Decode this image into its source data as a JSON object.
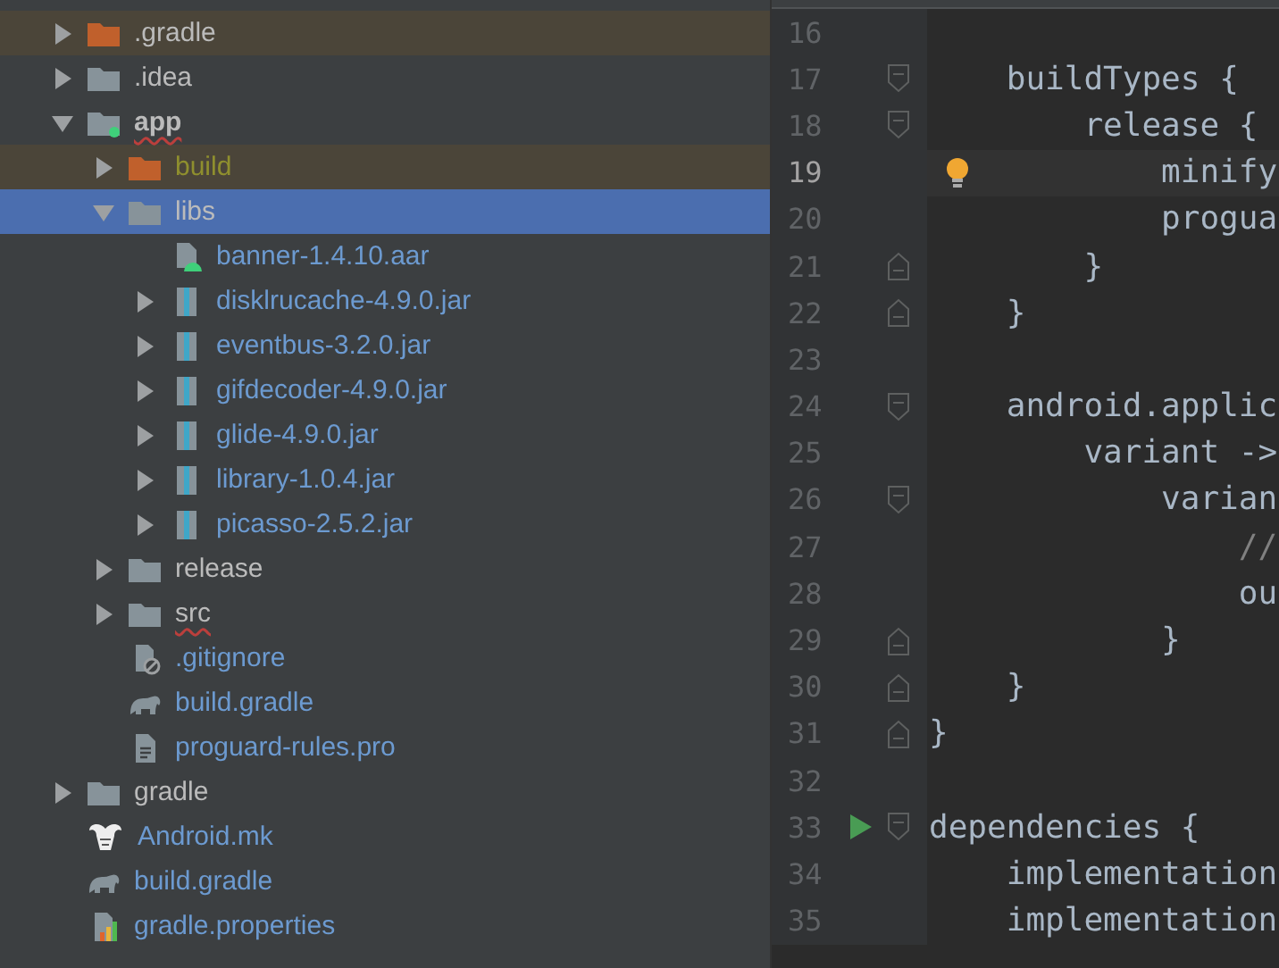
{
  "project_tree": {
    "items": [
      {
        "name": ".gradle",
        "kind": "folder-excluded",
        "expanded": false,
        "selected": false,
        "highlighted": true,
        "unversioned": false,
        "ignored": false,
        "bold": false,
        "error": false
      },
      {
        "name": ".idea",
        "kind": "folder",
        "expanded": false,
        "selected": false,
        "highlighted": false,
        "unversioned": false,
        "ignored": false,
        "bold": false,
        "error": false
      },
      {
        "name": "app",
        "kind": "module",
        "expanded": true,
        "selected": false,
        "highlighted": false,
        "unversioned": false,
        "ignored": false,
        "bold": true,
        "error": true,
        "children": [
          {
            "name": "build",
            "kind": "folder-excluded",
            "expanded": false,
            "selected": false,
            "highlighted": true,
            "ignored": true,
            "bold": false,
            "error": false
          },
          {
            "name": "libs",
            "kind": "folder",
            "expanded": true,
            "selected": true,
            "highlighted": false,
            "unversioned": false,
            "ignored": false,
            "bold": false,
            "error": false,
            "children": [
              {
                "name": "banner-1.4.10.aar",
                "kind": "aar",
                "selected": false,
                "highlighted": false,
                "unversioned": true,
                "ignored": false,
                "bold": false,
                "error": false
              },
              {
                "name": "disklrucache-4.9.0.jar",
                "kind": "jar",
                "expanded": false,
                "selected": false,
                "highlighted": false,
                "unversioned": true,
                "ignored": false,
                "bold": false,
                "error": false
              },
              {
                "name": "eventbus-3.2.0.jar",
                "kind": "jar",
                "expanded": false,
                "selected": false,
                "highlighted": false,
                "unversioned": true,
                "ignored": false,
                "bold": false,
                "error": false
              },
              {
                "name": "gifdecoder-4.9.0.jar",
                "kind": "jar",
                "expanded": false,
                "selected": false,
                "highlighted": false,
                "unversioned": true,
                "ignored": false,
                "bold": false,
                "error": false
              },
              {
                "name": "glide-4.9.0.jar",
                "kind": "jar",
                "expanded": false,
                "selected": false,
                "highlighted": false,
                "unversioned": true,
                "ignored": false,
                "bold": false,
                "error": false
              },
              {
                "name": "library-1.0.4.jar",
                "kind": "jar",
                "expanded": false,
                "selected": false,
                "highlighted": false,
                "unversioned": true,
                "ignored": false,
                "bold": false,
                "error": false
              },
              {
                "name": "picasso-2.5.2.jar",
                "kind": "jar",
                "expanded": false,
                "selected": false,
                "highlighted": false,
                "unversioned": true,
                "ignored": false,
                "bold": false,
                "error": false
              }
            ]
          },
          {
            "name": "release",
            "kind": "folder",
            "expanded": false,
            "selected": false,
            "highlighted": false,
            "unversioned": false,
            "ignored": false,
            "bold": false,
            "error": false
          },
          {
            "name": "src",
            "kind": "folder",
            "expanded": false,
            "selected": false,
            "highlighted": false,
            "unversioned": false,
            "ignored": false,
            "bold": false,
            "error": true
          },
          {
            "name": ".gitignore",
            "kind": "gitignore",
            "selected": false,
            "highlighted": false,
            "unversioned": true,
            "ignored": false,
            "bold": false,
            "error": false
          },
          {
            "name": "build.gradle",
            "kind": "gradle",
            "selected": false,
            "highlighted": false,
            "unversioned": true,
            "ignored": false,
            "bold": false,
            "error": false
          },
          {
            "name": "proguard-rules.pro",
            "kind": "text",
            "selected": false,
            "highlighted": false,
            "unversioned": true,
            "ignored": false,
            "bold": false,
            "error": false
          }
        ]
      },
      {
        "name": "gradle",
        "kind": "folder",
        "expanded": false,
        "selected": false,
        "highlighted": false,
        "unversioned": false,
        "ignored": false,
        "bold": false,
        "error": false
      },
      {
        "name": "Android.mk",
        "kind": "mk",
        "selected": false,
        "highlighted": false,
        "unversioned": true,
        "ignored": false,
        "bold": false,
        "error": false
      },
      {
        "name": "build.gradle",
        "kind": "gradle",
        "selected": false,
        "highlighted": false,
        "unversioned": true,
        "ignored": false,
        "bold": false,
        "error": false
      },
      {
        "name": "gradle.properties",
        "kind": "properties",
        "selected": false,
        "highlighted": false,
        "unversioned": true,
        "ignored": false,
        "bold": false,
        "error": false
      }
    ]
  },
  "editor": {
    "lines": [
      {
        "number": "16",
        "fold_start": false,
        "fold_end": false,
        "bulb": false,
        "run": false,
        "current": false
      },
      {
        "number": "17",
        "code": "    buildTypes {",
        "fold_start": true,
        "fold_end": false,
        "bulb": false,
        "run": false,
        "current": false,
        "kind": "code"
      },
      {
        "number": "18",
        "code": "        release {",
        "fold_start": true,
        "fold_end": false,
        "bulb": false,
        "run": false,
        "current": false,
        "kind": "code"
      },
      {
        "number": "19",
        "code": "            minify",
        "fold_start": false,
        "fold_end": false,
        "bulb": true,
        "run": false,
        "current": true,
        "kind": "code"
      },
      {
        "number": "20",
        "code": "            progua",
        "fold_start": false,
        "fold_end": false,
        "bulb": false,
        "run": false,
        "current": false,
        "kind": "code"
      },
      {
        "number": "21",
        "code": "        }",
        "fold_start": false,
        "fold_end": true,
        "bulb": false,
        "run": false,
        "current": false,
        "kind": "code"
      },
      {
        "number": "22",
        "code": "    }",
        "fold_start": false,
        "fold_end": true,
        "bulb": false,
        "run": false,
        "current": false,
        "kind": "code"
      },
      {
        "number": "23",
        "fold_start": false,
        "fold_end": false,
        "bulb": false,
        "run": false,
        "current": false
      },
      {
        "number": "24",
        "code": "    android.applic",
        "fold_start": true,
        "fold_end": false,
        "bulb": false,
        "run": false,
        "current": false,
        "kind": "code"
      },
      {
        "number": "25",
        "code": "        variant ->",
        "fold_start": false,
        "fold_end": false,
        "bulb": false,
        "run": false,
        "current": false,
        "kind": "code"
      },
      {
        "number": "26",
        "code": "            varian",
        "fold_start": true,
        "fold_end": false,
        "bulb": false,
        "run": false,
        "current": false,
        "kind": "code"
      },
      {
        "number": "27",
        "code": "                //",
        "fold_start": false,
        "fold_end": false,
        "bulb": false,
        "run": false,
        "current": false,
        "kind": "comment"
      },
      {
        "number": "28",
        "code": "                ou",
        "fold_start": false,
        "fold_end": false,
        "bulb": false,
        "run": false,
        "current": false,
        "kind": "code"
      },
      {
        "number": "29",
        "code": "            }",
        "fold_start": false,
        "fold_end": true,
        "bulb": false,
        "run": false,
        "current": false,
        "kind": "code"
      },
      {
        "number": "30",
        "code": "    }",
        "fold_start": false,
        "fold_end": true,
        "bulb": false,
        "run": false,
        "current": false,
        "kind": "code"
      },
      {
        "number": "31",
        "code": "}",
        "fold_start": false,
        "fold_end": true,
        "bulb": false,
        "run": false,
        "current": false,
        "kind": "code"
      },
      {
        "number": "32",
        "fold_start": false,
        "fold_end": false,
        "bulb": false,
        "run": false,
        "current": false
      },
      {
        "number": "33",
        "code": "dependencies {",
        "fold_start": true,
        "fold_end": false,
        "bulb": false,
        "run": true,
        "current": false,
        "kind": "code"
      },
      {
        "number": "34",
        "code": "    implementation",
        "fold_start": false,
        "fold_end": false,
        "bulb": false,
        "run": false,
        "current": false,
        "kind": "code"
      },
      {
        "number": "35",
        "code": "    implementation",
        "fold_start": false,
        "fold_end": false,
        "bulb": false,
        "run": false,
        "current": false,
        "kind": "code"
      }
    ]
  }
}
